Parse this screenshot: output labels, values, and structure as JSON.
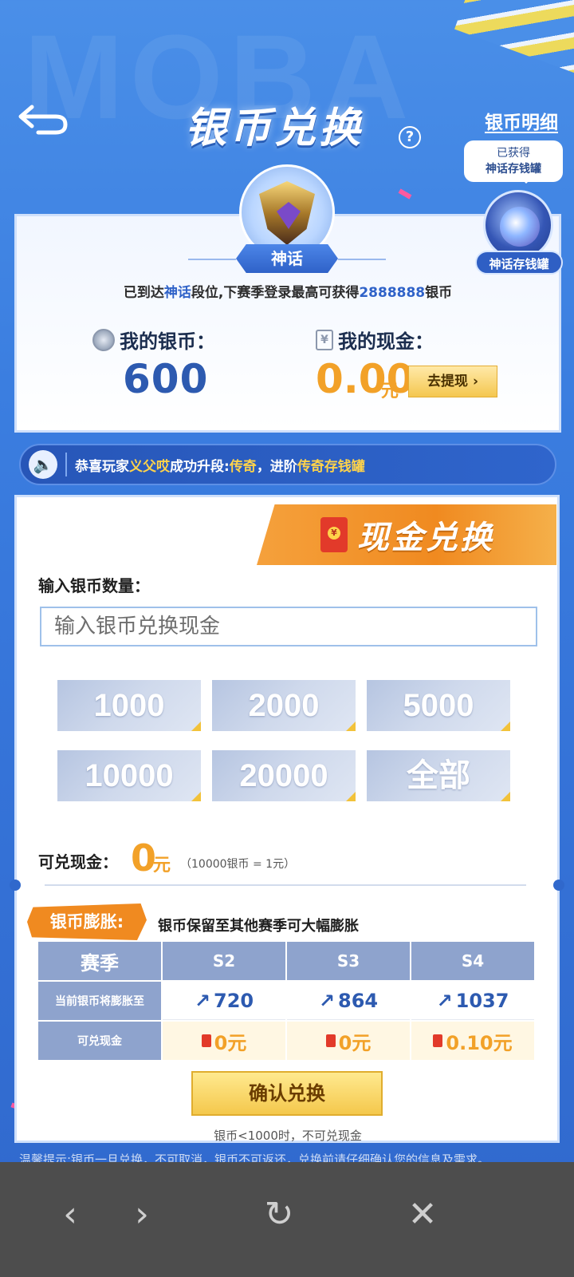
{
  "header": {
    "title": "银币兑换",
    "help": "?",
    "detail_link": "银币明细"
  },
  "tooltip": {
    "line1": "已获得",
    "line2": "神话存钱罐"
  },
  "piggy_label": "神话存钱罐",
  "rank": {
    "badge": "神话",
    "desc_prefix": "已到达",
    "desc_rank": "神话",
    "desc_mid": "段位,下赛季登录最高可获得",
    "desc_amount": "2888888",
    "desc_suffix": "银币"
  },
  "balance": {
    "coin_label": "我的银币：",
    "coin_value": "600",
    "cash_label": "我的现金：",
    "cash_value": "0.00",
    "cash_unit": "元",
    "withdraw": "去提现 ›"
  },
  "notice": {
    "prefix": "恭喜玩家",
    "player": "义父哎",
    "mid": "成功升段:",
    "rank": "传奇",
    "mid2": "，进阶",
    "jar": "传奇存钱罐"
  },
  "exchange": {
    "section_title": "现金兑换",
    "input_label": "输入银币数量：",
    "input_placeholder": "输入银币兑换现金",
    "amounts": [
      "1000",
      "2000",
      "5000",
      "10000",
      "20000",
      "全部"
    ],
    "result_label": "可兑现金：",
    "result_value": "0",
    "result_unit": "元",
    "rate": "（10000银币 = 1元）"
  },
  "inflation": {
    "tag": "银币膨胀:",
    "desc": "银币保留至其他赛季可大幅膨胀",
    "header": [
      "赛季",
      "S2",
      "S3",
      "S4"
    ],
    "row1_label": "当前银币将膨胀至",
    "row1": [
      "720",
      "864",
      "1037"
    ],
    "row2_label": "可兑现金",
    "row2": [
      "0元",
      "0元",
      "0.10元"
    ]
  },
  "confirm": {
    "button": "确认兑换",
    "note": "银币<1000时，不可兑现金"
  },
  "tip": "温馨提示:银币一旦兑换，不可取消，银币不可返还，兑换前请仔细确认您的信息及需求。",
  "browser": {
    "back": "‹",
    "forward": "›",
    "reload": "↻",
    "close": "✕"
  },
  "colors": {
    "accent_orange": "#f2a128",
    "primary_blue": "#2d5ab0",
    "background_blue": "#3b7ee0"
  }
}
